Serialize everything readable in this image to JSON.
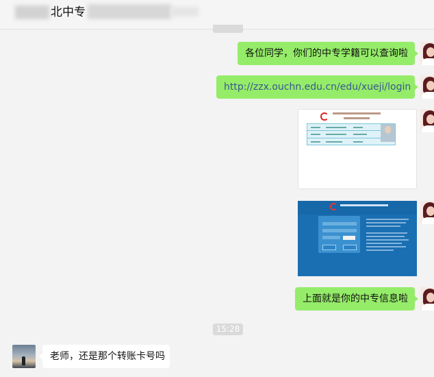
{
  "header": {
    "title": "北中专"
  },
  "messages": [
    {
      "from": "me",
      "type": "text",
      "text": "各位同学，你们的中专学籍可以查询啦"
    },
    {
      "from": "me",
      "type": "link",
      "text": "http://zzx.ouchn.edu.cn/edu/xueji/login"
    },
    {
      "from": "me",
      "type": "image",
      "image_desc": "student-record-screenshot"
    },
    {
      "from": "me",
      "type": "image",
      "image_desc": "login-page-screenshot"
    },
    {
      "from": "me",
      "type": "text",
      "text": "上面就是你的中专信息啦"
    },
    {
      "from": "other",
      "type": "text",
      "text": "老师，还是那个转账卡号吗"
    }
  ],
  "timestamp": "15:28",
  "colors": {
    "sent_bubble": "#95ec69",
    "received_bubble": "#ffffff",
    "background": "#f3f3f3",
    "link": "#38588f"
  }
}
